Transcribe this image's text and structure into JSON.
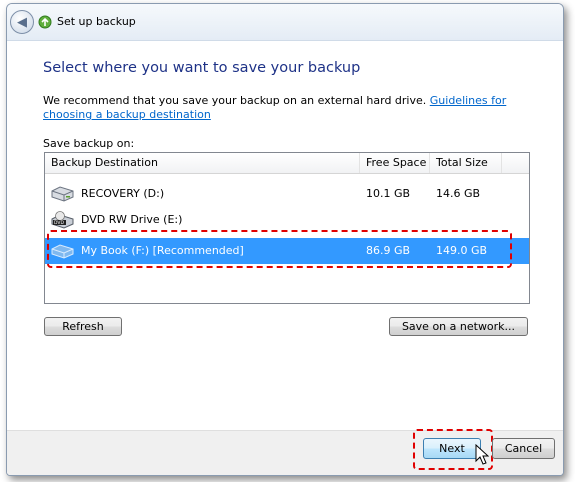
{
  "window": {
    "title": "Set up backup"
  },
  "main": {
    "heading": "Select where you want to save your backup",
    "recommend_text": "We recommend that you save your backup on an external hard drive. ",
    "guidelines_link": "Guidelines for choosing a backup destination",
    "save_on_label": "Save backup on:"
  },
  "table": {
    "columns": [
      "Backup Destination",
      "Free Space",
      "Total Size"
    ],
    "rows": [
      {
        "name": "RECOVERY (D:)",
        "free": "10.1 GB",
        "total": "14.6 GB",
        "icon": "hard-drive-icon",
        "selected": false
      },
      {
        "name": "DVD RW Drive (E:)",
        "free": "",
        "total": "",
        "icon": "dvd-drive-icon",
        "selected": false
      },
      {
        "name": "My Book (F:) [Recommended]",
        "free": "86.9 GB",
        "total": "149.0 GB",
        "icon": "external-drive-icon",
        "selected": true
      }
    ]
  },
  "buttons": {
    "refresh": "Refresh",
    "save_network": "Save on a network...",
    "next": "Next",
    "cancel": "Cancel"
  },
  "colors": {
    "heading": "#1e3287",
    "link": "#0066cc",
    "selection": "#3399ff",
    "highlight_dash": "#e00000"
  }
}
